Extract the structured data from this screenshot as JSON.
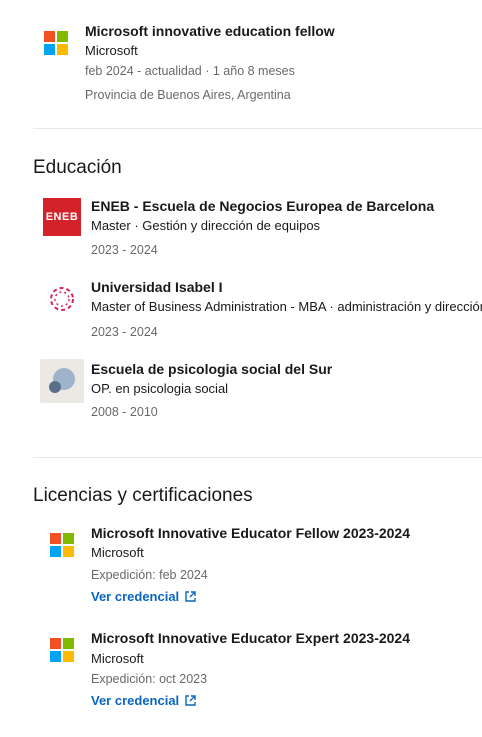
{
  "experience": {
    "title": "Microsoft innovative education fellow",
    "company": "Microsoft",
    "dates": "feb 2024 - actualidad  · 1 año 8 meses",
    "location": "Provincia de Buenos Aires, Argentina"
  },
  "education": {
    "heading": "Educación",
    "items": [
      {
        "school": "ENEB - Escuela de Negocios Europea de Barcelona",
        "degree": "Master  · Gestión y dirección de equipos",
        "dates": "2023 - 2024",
        "logo_text": "ENEB"
      },
      {
        "school": "Universidad Isabel I",
        "degree": "Master of Business Administration - MBA  · administración y dirección",
        "dates": "2023 - 2024"
      },
      {
        "school": "Escuela de psicologia social del Sur",
        "degree": "OP. en psicologia social",
        "dates": "2008 - 2010"
      }
    ]
  },
  "licenses": {
    "heading": "Licencias y certificaciones",
    "items": [
      {
        "name": "Microsoft Innovative Educator Fellow 2023-2024",
        "issuer": "Microsoft",
        "issued": "Expedición: feb 2024",
        "link": "Ver credencial"
      },
      {
        "name": "Microsoft Innovative Educator Expert 2023-2024",
        "issuer": "Microsoft",
        "issued": "Expedición: oct 2023",
        "link": "Ver credencial"
      }
    ]
  },
  "colors": {
    "ms_red": "#f25022",
    "ms_green": "#7fba00",
    "ms_blue": "#00a4ef",
    "ms_yellow": "#ffb900",
    "link_blue": "#0a66c2",
    "eneb_red": "#d3222a",
    "isabel_pink": "#d6245f"
  }
}
